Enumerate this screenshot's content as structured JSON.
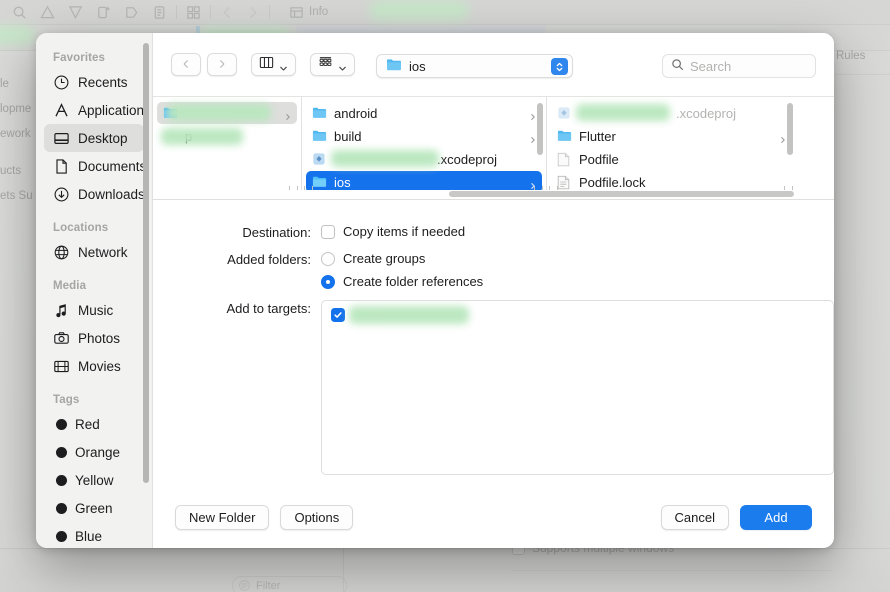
{
  "background": {
    "info_tab_label": "Info",
    "rules_tab_label": "Rules",
    "navigator_lines": [
      "le",
      "lopme",
      "ework",
      "ucts",
      "ets Su"
    ],
    "supports_multiple_windows_label": "Supports multiple windows",
    "filter_placeholder": "Filter"
  },
  "sheet": {
    "sidebar": {
      "groups": [
        {
          "title": "Favorites",
          "items": [
            {
              "label": "Recents",
              "icon": "clock-icon",
              "selected": false
            },
            {
              "label": "Applications",
              "icon": "applications-icon",
              "selected": false
            },
            {
              "label": "Desktop",
              "icon": "desktop-icon",
              "selected": true
            },
            {
              "label": "Documents",
              "icon": "document-icon",
              "selected": false
            },
            {
              "label": "Downloads",
              "icon": "download-icon",
              "selected": false
            }
          ]
        },
        {
          "title": "Locations",
          "items": [
            {
              "label": "Network",
              "icon": "network-globe-icon",
              "selected": false
            }
          ]
        },
        {
          "title": "Media",
          "items": [
            {
              "label": "Music",
              "icon": "music-note-icon",
              "selected": false
            },
            {
              "label": "Photos",
              "icon": "camera-icon",
              "selected": false
            },
            {
              "label": "Movies",
              "icon": "film-icon",
              "selected": false
            }
          ]
        },
        {
          "title": "Tags",
          "items": [
            {
              "label": "Red",
              "icon": "tag-dot-icon",
              "color": "#1d1d1f",
              "selected": false
            },
            {
              "label": "Orange",
              "icon": "tag-dot-icon",
              "color": "#1d1d1f",
              "selected": false
            },
            {
              "label": "Yellow",
              "icon": "tag-dot-icon",
              "color": "#1d1d1f",
              "selected": false
            },
            {
              "label": "Green",
              "icon": "tag-dot-icon",
              "color": "#1d1d1f",
              "selected": false
            },
            {
              "label": "Blue",
              "icon": "tag-dot-icon",
              "color": "#1d1d1f",
              "selected": false
            }
          ]
        }
      ]
    },
    "toolbar": {
      "back_icon": "chevron-left-icon",
      "forward_icon": "chevron-right-icon",
      "view_mode_icon": "column-view-icon",
      "group_by_icon": "group-by-icon",
      "path_value": "ios",
      "path_icon": "folder-icon",
      "search_placeholder": "Search",
      "search_icon": "search-icon"
    },
    "browser": {
      "columns": [
        {
          "items": [
            {
              "label": "",
              "redacted": true,
              "icon": "folder-icon",
              "state": "selected-gray",
              "disclosure": true
            },
            {
              "label": "p",
              "redacted": true,
              "icon": "none",
              "state": "normal",
              "disclosure": false
            }
          ]
        },
        {
          "items": [
            {
              "label": "android",
              "redacted": false,
              "icon": "folder-icon",
              "state": "normal",
              "disclosure": true
            },
            {
              "label": "build",
              "redacted": false,
              "icon": "folder-icon",
              "state": "normal",
              "disclosure": true
            },
            {
              "label": ".xcodeproj",
              "redacted": true,
              "icon": "xcodeproj-icon",
              "state": "normal",
              "disclosure": false
            },
            {
              "label": "ios",
              "redacted": false,
              "icon": "folder-icon",
              "state": "selected-blue",
              "disclosure": true
            }
          ]
        },
        {
          "items": [
            {
              "label": ".xcodeproj",
              "redacted": true,
              "icon": "xcodeproj-icon",
              "state": "dim",
              "disclosure": false
            },
            {
              "label": "Flutter",
              "redacted": false,
              "icon": "folder-icon",
              "state": "normal",
              "disclosure": true
            },
            {
              "label": "Podfile",
              "redacted": false,
              "icon": "plain-file-icon",
              "state": "normal",
              "disclosure": false
            },
            {
              "label": "Podfile.lock",
              "redacted": false,
              "icon": "text-file-icon",
              "state": "normal",
              "disclosure": false
            }
          ]
        }
      ]
    },
    "options": {
      "destination_label": "Destination:",
      "copy_items_label": "Copy items if needed",
      "copy_items_checked": false,
      "added_folders_label": "Added folders:",
      "create_groups_label": "Create groups",
      "create_groups_selected": false,
      "create_folder_references_label": "Create folder references",
      "create_folder_references_selected": true,
      "add_to_targets_label": "Add to targets:",
      "targets": [
        {
          "label": "",
          "redacted": true,
          "checked": true
        }
      ]
    },
    "footer": {
      "new_folder_label": "New Folder",
      "options_label": "Options",
      "cancel_label": "Cancel",
      "add_label": "Add"
    }
  },
  "colors": {
    "accent": "#1472ec",
    "primary_button": "#1b7cee",
    "selection_gray": "#dededd",
    "folder_blue": "#52b9f0",
    "redaction_green": "#b9e7be"
  }
}
